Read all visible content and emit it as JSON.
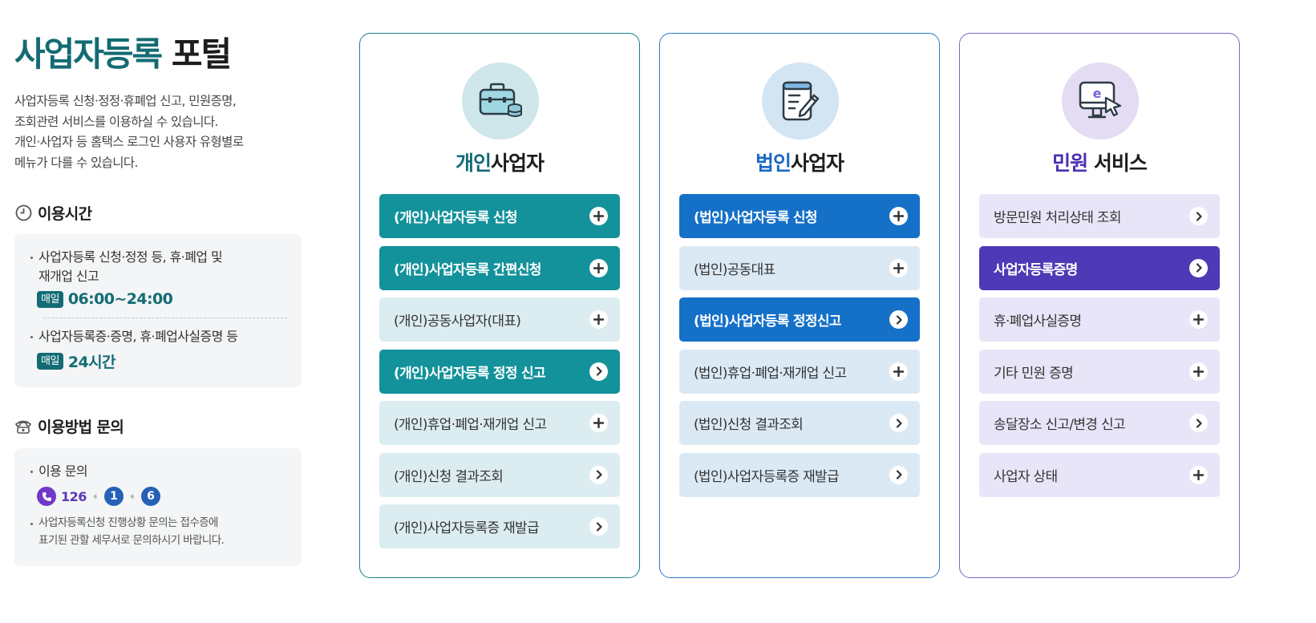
{
  "portal": {
    "title_accent": "사업자등록",
    "title_rest": "포털",
    "description": "사업자등록 신청·정정·휴폐업 신고, 민원증명,\n조회관련 서비스를 이용하실 수 있습니다.\n개인·사업자 등 홈택스 로그인 사용자 유형별로\n메뉴가 다를 수 있습니다."
  },
  "hours": {
    "heading": "이용시간",
    "icon": "clock-icon",
    "items": [
      {
        "text": "사업자등록 신청·정정 등, 휴·폐업 및\n재개업 신고",
        "badge": "매일",
        "time": "06:00~24:00"
      },
      {
        "text": "사업자등록증·증명, 휴·폐업사실증명 등",
        "badge": "매일",
        "time": "24시간"
      }
    ]
  },
  "inquiry": {
    "heading": "이용방법 문의",
    "icon": "telephone-icon",
    "label": "이용 문의",
    "phone": "126",
    "steps": [
      "1",
      "6"
    ],
    "note": "사업자등록신청 진행상황 문의는 접수증에\n표기된 관할 세무서로 문의하시기 바랍니다."
  },
  "cards": {
    "personal": {
      "title_hl": "개인",
      "title_rest": "사업자",
      "icon": "briefcase-icon",
      "items": [
        {
          "label": "(개인)사업자등록 신청",
          "icon": "plus",
          "style": "dark"
        },
        {
          "label": "(개인)사업자등록 간편신청",
          "icon": "plus",
          "style": "dark"
        },
        {
          "label": "(개인)공동사업자(대표)",
          "icon": "plus",
          "style": "light"
        },
        {
          "label": "(개인)사업자등록 정정 신고",
          "icon": "chevron",
          "style": "dark"
        },
        {
          "label": "(개인)휴업·폐업·재개업 신고",
          "icon": "plus",
          "style": "light"
        },
        {
          "label": "(개인)신청 결과조회",
          "icon": "chevron",
          "style": "light"
        },
        {
          "label": "(개인)사업자등록증 재발급",
          "icon": "chevron",
          "style": "light"
        }
      ]
    },
    "corporate": {
      "title_hl": "법인",
      "title_rest": "사업자",
      "icon": "document-pen-icon",
      "items": [
        {
          "label": "(법인)사업자등록 신청",
          "icon": "plus",
          "style": "dark"
        },
        {
          "label": "(법인)공동대표",
          "icon": "plus",
          "style": "light"
        },
        {
          "label": "(법인)사업자등록 정정신고",
          "icon": "chevron",
          "style": "dark"
        },
        {
          "label": "(법인)휴업·폐업·재개업 신고",
          "icon": "plus",
          "style": "light"
        },
        {
          "label": "(법인)신청 결과조회",
          "icon": "chevron",
          "style": "light"
        },
        {
          "label": "(법인)사업자등록증 재발급",
          "icon": "chevron",
          "style": "light"
        }
      ]
    },
    "civil": {
      "title_hl": "민원",
      "title_rest": "서비스",
      "icon": "e-monitor-icon",
      "items": [
        {
          "label": "방문민원 처리상태 조회",
          "icon": "chevron",
          "style": "light"
        },
        {
          "label": "사업자등록증명",
          "icon": "chevron",
          "style": "dark"
        },
        {
          "label": "휴·폐업사실증명",
          "icon": "plus",
          "style": "light"
        },
        {
          "label": "기타 민원 증명",
          "icon": "plus",
          "style": "light"
        },
        {
          "label": "송달장소 신고/변경 신고",
          "icon": "chevron",
          "style": "light"
        },
        {
          "label": "사업자 상태",
          "icon": "plus",
          "style": "light"
        }
      ]
    }
  },
  "colors": {
    "personal_accent": "#13929b",
    "corporate_accent": "#1570c8",
    "civil_accent": "#4e39b6"
  }
}
